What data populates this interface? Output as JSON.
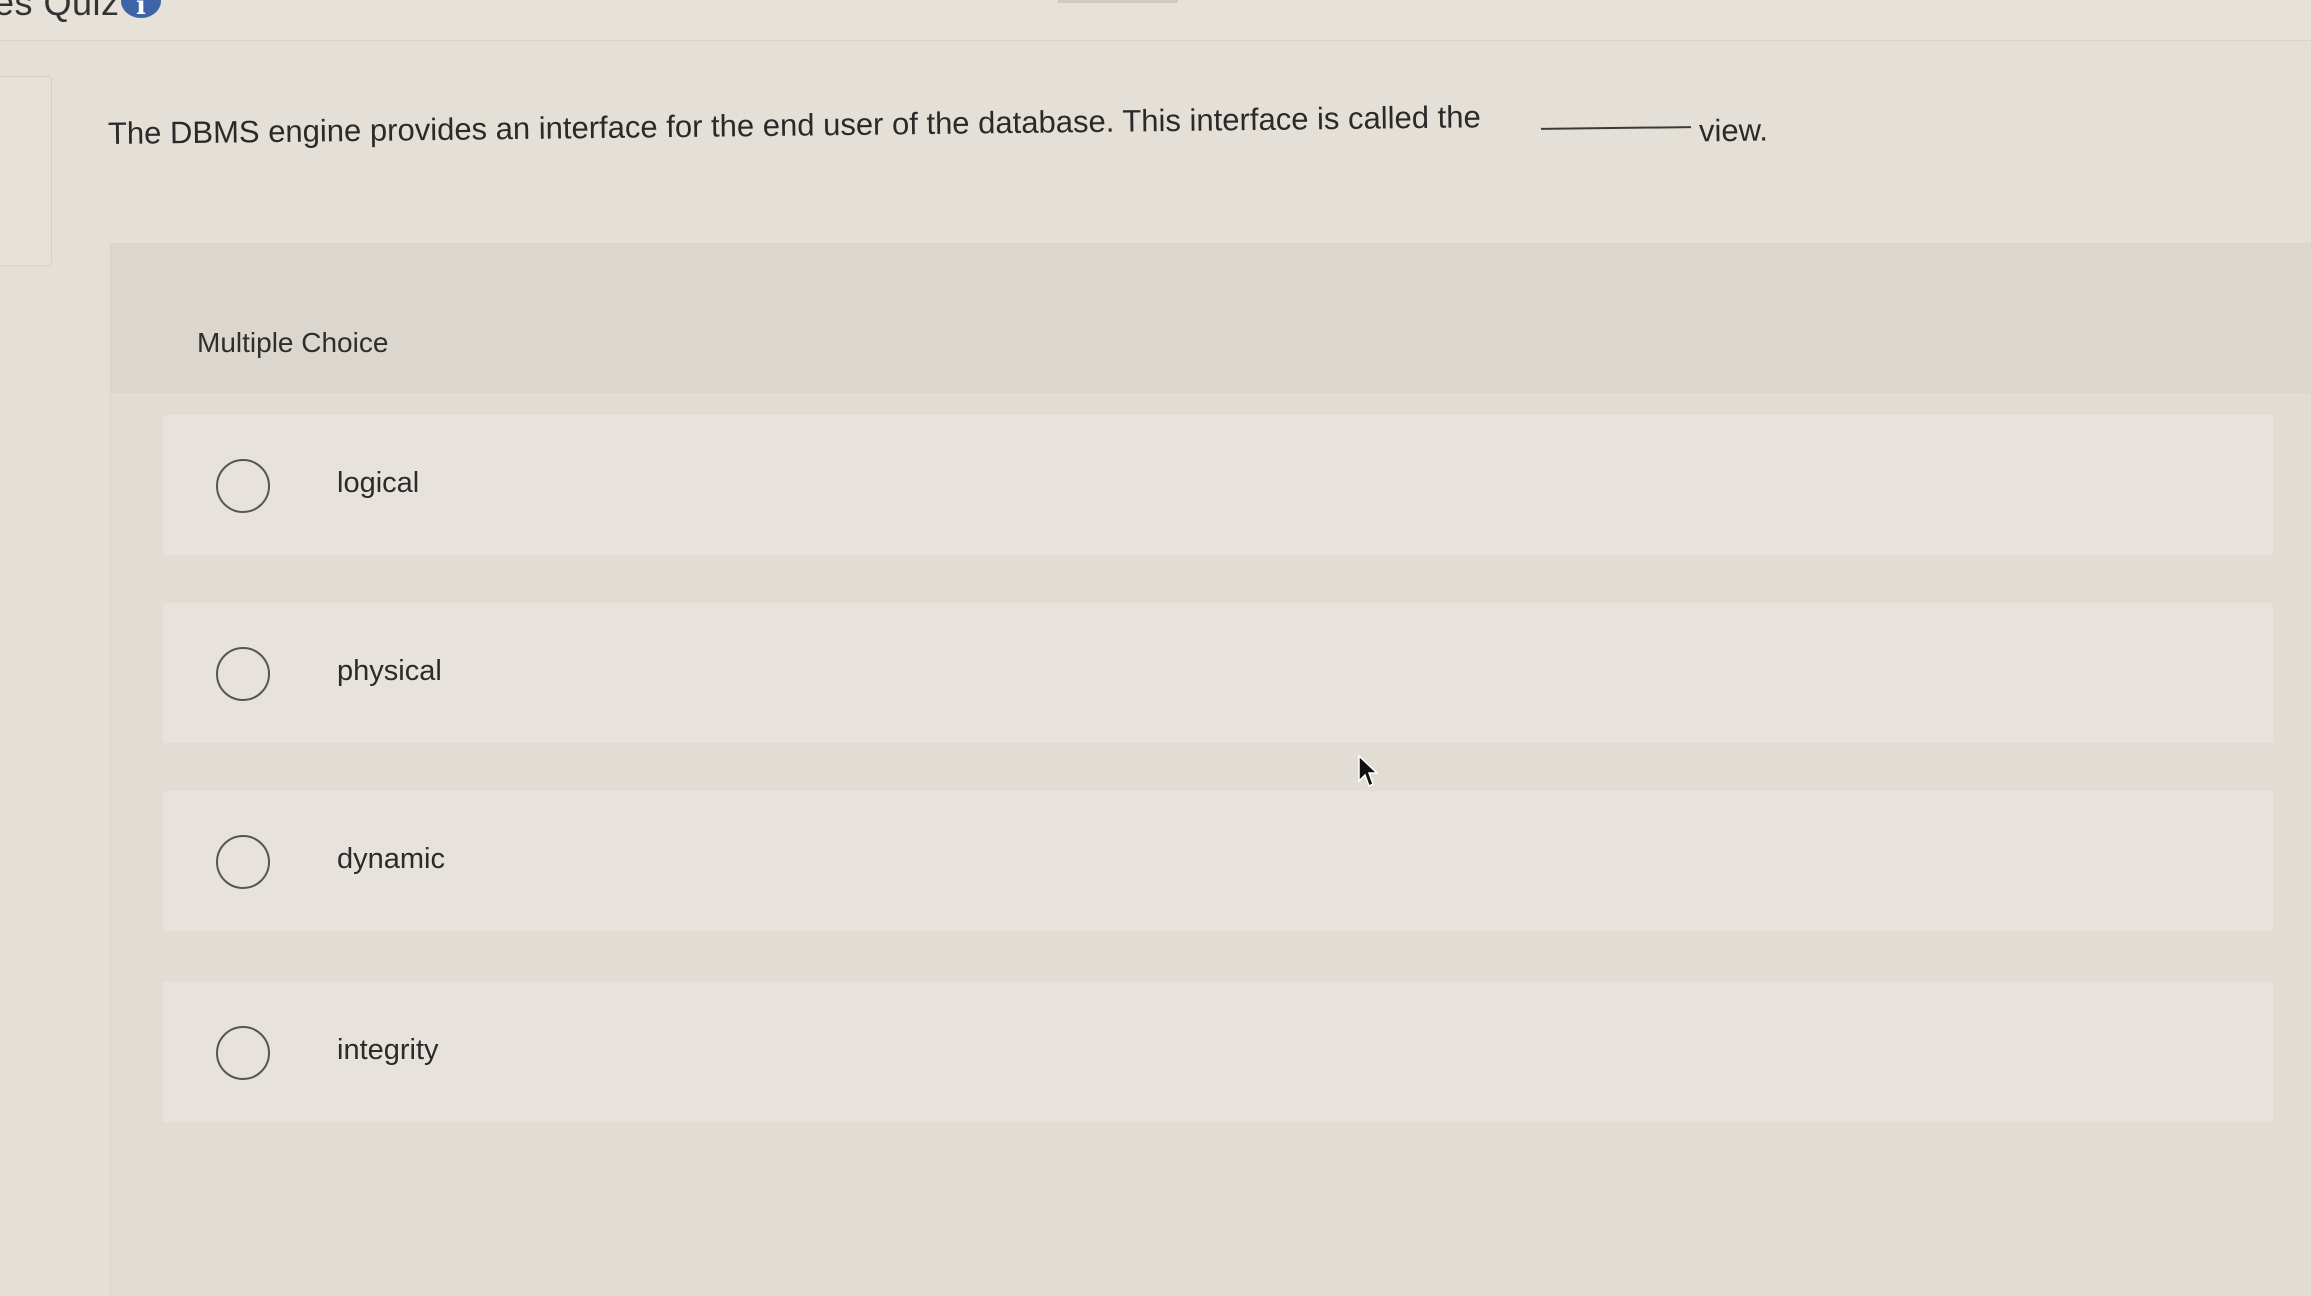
{
  "header": {
    "title": "es Quiz",
    "info_icon": "info-icon",
    "info_glyph": "i"
  },
  "question": {
    "text": "The DBMS engine provides an interface for the end user of the database. This interface is called the",
    "after_blank": "view."
  },
  "answer_panel": {
    "type_label": "Multiple Choice",
    "options": [
      {
        "label": "logical",
        "selected": false
      },
      {
        "label": "physical",
        "selected": false
      },
      {
        "label": "dynamic",
        "selected": false
      },
      {
        "label": "integrity",
        "selected": false
      }
    ]
  },
  "colors": {
    "accent": "#3e63a8",
    "background": "#e4e0d8",
    "option_background": "#e7e3dc"
  }
}
